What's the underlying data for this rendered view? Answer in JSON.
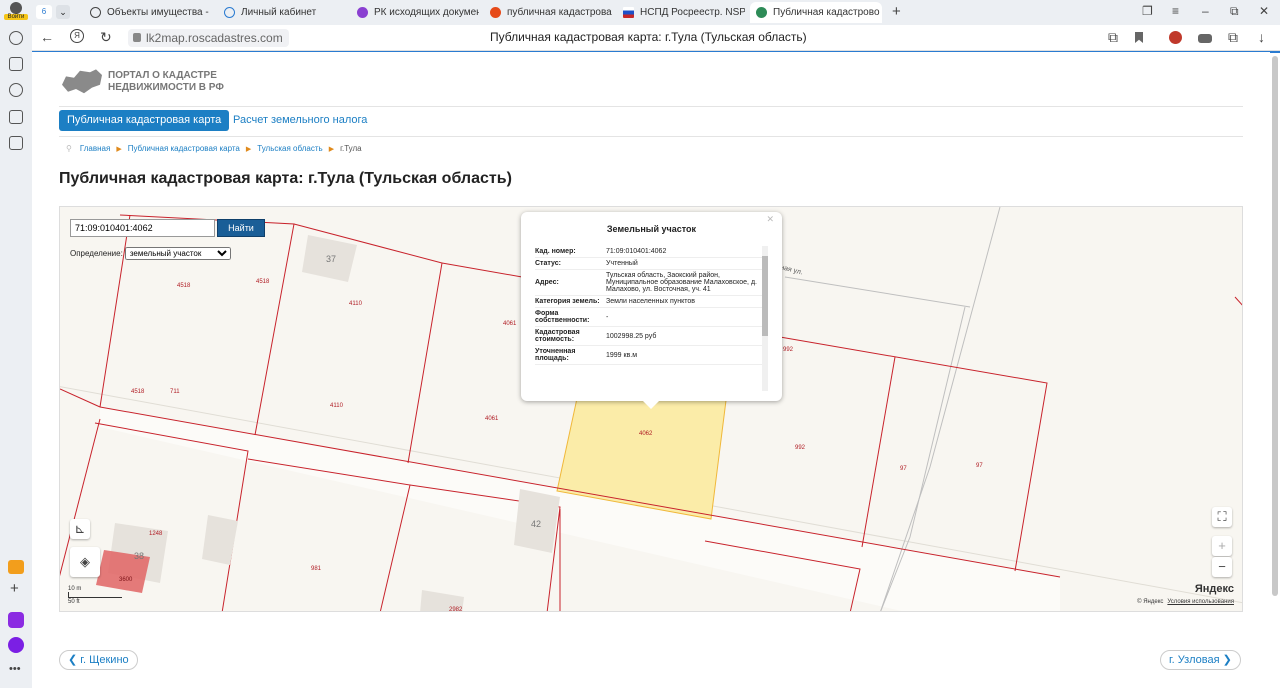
{
  "browser": {
    "tab_count": "6",
    "tabs": [
      {
        "label": "Объекты имущества - Ф",
        "color": "#444"
      },
      {
        "label": "Личный кабинет",
        "color": "#2a7bd1"
      },
      {
        "label": "РК исходящих докумен",
        "color": "#8a3fd1"
      },
      {
        "label": "публичная кадастрова",
        "color": "#e64a19"
      },
      {
        "label": "НСПД Росреестр. NSPD п",
        "color": "#c62828"
      },
      {
        "label": "Публичная кадастрово",
        "color": "#2e8b57"
      }
    ],
    "url": "lk2map.roscadastres.com",
    "page_title": "Публичная кадастровая карта: г.Тула (Тульская область)",
    "profile_label": "Войти"
  },
  "site": {
    "logo_line1": "ПОРТАЛ О КАДАСТРЕ",
    "logo_line2": "НЕДВИЖИМОСТИ В РФ",
    "nav_primary": "Публичная кадастровая карта",
    "nav_link": "Расчет земельного налога",
    "breadcrumbs": [
      "Главная",
      "Публичная кадастровая карта",
      "Тульская область",
      "г.Тула"
    ],
    "heading": "Публичная кадастровая карта: г.Тула (Тульская область)"
  },
  "map": {
    "search_value": "71:09:010401:4062",
    "search_button": "Найти",
    "define_label": "Определение:",
    "define_value": "земельный участок",
    "popup": {
      "title": "Земельный участок",
      "rows": [
        {
          "k": "Кад. номер:",
          "v": "71:09:010401:4062"
        },
        {
          "k": "Статус:",
          "v": "Учтенный"
        },
        {
          "k": "Адрес:",
          "v": "Тульская область, Заокский район, Муниципальное образование Малаховское, д. Малахово, ул. Восточная, уч. 41"
        },
        {
          "k": "Категория земель:",
          "v": "Земли населенных пунктов"
        },
        {
          "k": "Форма собственности:",
          "v": "-"
        },
        {
          "k": "Кадастровая стоимость:",
          "v": "1002998.25 руб"
        },
        {
          "k": "Уточненная площадь:",
          "v": "1999 кв.м"
        }
      ]
    },
    "parcel_labels": [
      "4518",
      "4518",
      "4110",
      "4061",
      "4518",
      "711",
      "4110",
      "4061",
      "4062",
      "992",
      "992",
      "97",
      "97",
      "1248",
      "3600",
      "981",
      "2982"
    ],
    "house_labels": [
      "37",
      "42",
      "38"
    ],
    "street_label": "ная ул.",
    "scale_m": "10 m",
    "scale_ft": "50 ft",
    "yandex": "Яндекс",
    "copyright": "© Яндекс",
    "terms": "Условия использования"
  },
  "pager": {
    "prev": "г. Щекино",
    "next": "г. Узловая"
  }
}
